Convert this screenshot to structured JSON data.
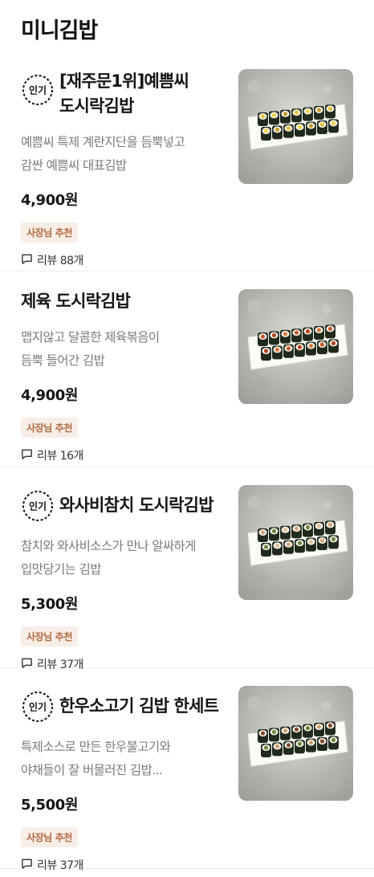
{
  "section": {
    "title": "미니김밥"
  },
  "badge_text": "인기",
  "items": [
    {
      "popular": true,
      "name_line1": "[재주문1위]예쁨씨",
      "name_line2": "도시락김밥",
      "desc_line1": "예쁨씨 특제 계란지단을 듬뿍넣고",
      "desc_line2": "감싼 예쁨씨 대표김밥",
      "price": "4,900원",
      "tag": "사장님 추천",
      "review": "리뷰 88개",
      "image_icon": "gimbap-photo"
    },
    {
      "popular": false,
      "name_line1": "제육 도시락김밥",
      "name_line2": "",
      "desc_line1": "맵지않고 달콤한 제육볶음이",
      "desc_line2": "듬뿍 들어간 김밥",
      "price": "4,900원",
      "tag": "사장님 추천",
      "review": "리뷰 16개",
      "image_icon": "gimbap-photo"
    },
    {
      "popular": true,
      "name_line1": "와사비참치 도시락김밥",
      "name_line2": "",
      "desc_line1": "참치와 와사비소스가 만나 알싸하게",
      "desc_line2": "입맛당기는 김밥",
      "price": "5,300원",
      "tag": "사장님 추천",
      "review": "리뷰 37개",
      "image_icon": "gimbap-photo"
    },
    {
      "popular": true,
      "name_line1": "한우소고기 김밥 한세트",
      "name_line2": "",
      "desc_line1": "특제소스로 만든 한우불고기와",
      "desc_line2": "야채들이 잘 버물러진 김밥...",
      "price": "5,500원",
      "tag": "사장님 추천",
      "review": "리뷰 37개",
      "image_icon": "gimbap-photo"
    }
  ],
  "colors": {
    "tag_bg": "#f8eee7",
    "tag_text": "#b2693f",
    "title": "#151515",
    "desc": "#7a7a7a"
  }
}
